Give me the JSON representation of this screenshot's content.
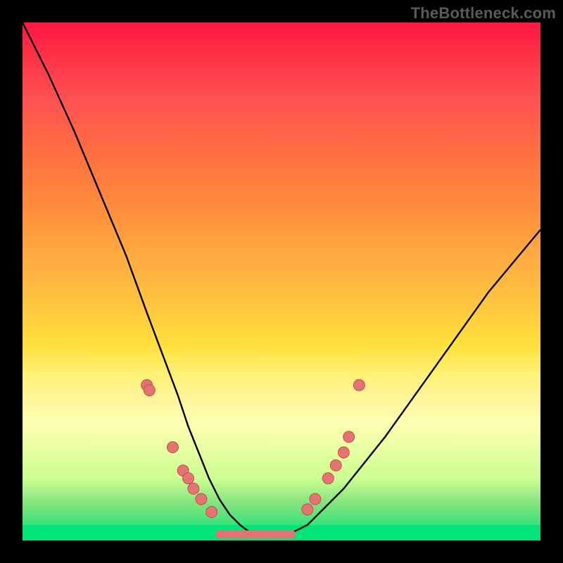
{
  "watermark": "TheBottleneck.com",
  "colors": {
    "curve": "#000000",
    "marker_fill": "#e57373",
    "marker_stroke": "#c94f4f",
    "bottom_line": "#e57373"
  },
  "chart_data": {
    "type": "line",
    "title": "",
    "xlabel": "",
    "ylabel": "",
    "xlim": [
      0,
      100
    ],
    "ylim": [
      0,
      100
    ],
    "curve": {
      "x": [
        0,
        5,
        10,
        15,
        20,
        24,
        27,
        30,
        32,
        34,
        36,
        38,
        40,
        42,
        44,
        46,
        48,
        50,
        52,
        55,
        58,
        62,
        66,
        70,
        75,
        80,
        85,
        90,
        95,
        100
      ],
      "y": [
        100,
        90,
        79,
        67,
        55,
        44,
        36,
        28,
        22,
        17,
        12,
        8,
        5,
        3,
        1.5,
        1,
        1,
        1,
        1.5,
        3,
        6,
        10,
        15,
        20,
        27,
        34,
        41,
        48,
        54,
        60
      ]
    },
    "markers_left": {
      "x": [
        24.0,
        24.5,
        29.0,
        31.0,
        32.0,
        33.0,
        34.5,
        36.5
      ],
      "y": [
        30.0,
        29.0,
        18.0,
        13.5,
        12.0,
        10.0,
        8.0,
        5.5
      ]
    },
    "markers_right": {
      "x": [
        55.0,
        56.5,
        59.0,
        60.5,
        62.0,
        63.0,
        65.0
      ],
      "y": [
        6.0,
        8.0,
        12.0,
        14.5,
        17.0,
        20.0,
        30.0
      ]
    },
    "bottom_segment": {
      "x0": 38,
      "x1": 52,
      "y": 1.2
    }
  }
}
